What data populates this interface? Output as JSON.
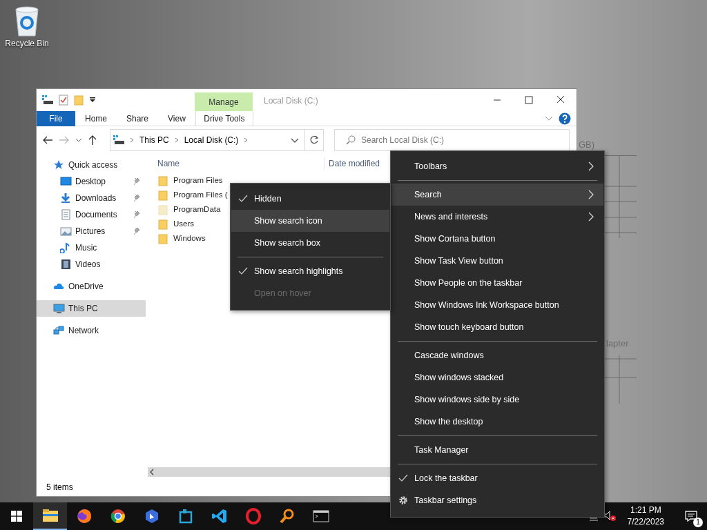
{
  "desktop": {
    "icons": [
      {
        "label": "Recycle Bin"
      }
    ],
    "background_texts": [
      "GB)",
      "lapter"
    ]
  },
  "explorer": {
    "title": "Local Disk (C:)",
    "context_group": "Manage",
    "ribbon_tabs": [
      {
        "label": "File",
        "kind": "file"
      },
      {
        "label": "Home",
        "kind": "tab"
      },
      {
        "label": "Share",
        "kind": "tab"
      },
      {
        "label": "View",
        "kind": "tab"
      },
      {
        "label": "Drive Tools",
        "kind": "context"
      }
    ],
    "breadcrumbs": [
      "This PC",
      "Local Disk (C:)"
    ],
    "search": {
      "placeholder": "Search Local Disk (C:)"
    },
    "nav": [
      {
        "label": "Quick access",
        "selected": false,
        "pinned": false,
        "children": [
          {
            "label": "Desktop",
            "selected": false,
            "pinned": true
          },
          {
            "label": "Downloads",
            "selected": false,
            "pinned": true
          },
          {
            "label": "Documents",
            "selected": false,
            "pinned": true
          },
          {
            "label": "Pictures",
            "selected": false,
            "pinned": true
          },
          {
            "label": "Music",
            "selected": false,
            "pinned": false
          },
          {
            "label": "Videos",
            "selected": false,
            "pinned": false
          }
        ]
      },
      {
        "label": "OneDrive",
        "selected": false,
        "pinned": false
      },
      {
        "label": "This PC",
        "selected": true,
        "pinned": false
      },
      {
        "label": "Network",
        "selected": false,
        "pinned": false
      }
    ],
    "columns": [
      "Name",
      "Date modified"
    ],
    "files": [
      {
        "name": "Program Files",
        "hidden": false
      },
      {
        "name": "Program Files (",
        "hidden": false
      },
      {
        "name": "ProgramData",
        "hidden": true
      },
      {
        "name": "Users",
        "hidden": false
      },
      {
        "name": "Windows",
        "hidden": false
      }
    ],
    "status": "5 items"
  },
  "taskbar_menu": [
    {
      "kind": "item",
      "label": "Toolbars",
      "submenu": true,
      "selected": false,
      "checked": false
    },
    {
      "kind": "separator"
    },
    {
      "kind": "item",
      "label": "Search",
      "submenu": true,
      "selected": true,
      "checked": false
    },
    {
      "kind": "item",
      "label": "News and interests",
      "submenu": true,
      "selected": false,
      "checked": false
    },
    {
      "kind": "item",
      "label": "Show Cortana button",
      "submenu": false,
      "selected": false,
      "checked": false
    },
    {
      "kind": "item",
      "label": "Show Task View button",
      "submenu": false,
      "selected": false,
      "checked": false
    },
    {
      "kind": "item",
      "label": "Show People on the taskbar",
      "submenu": false,
      "selected": false,
      "checked": false
    },
    {
      "kind": "item",
      "label": "Show Windows Ink Workspace button",
      "submenu": false,
      "selected": false,
      "checked": false
    },
    {
      "kind": "item",
      "label": "Show touch keyboard button",
      "submenu": false,
      "selected": false,
      "checked": false
    },
    {
      "kind": "separator"
    },
    {
      "kind": "item",
      "label": "Cascade windows",
      "submenu": false,
      "selected": false,
      "checked": false
    },
    {
      "kind": "item",
      "label": "Show windows stacked",
      "submenu": false,
      "selected": false,
      "checked": false
    },
    {
      "kind": "item",
      "label": "Show windows side by side",
      "submenu": false,
      "selected": false,
      "checked": false
    },
    {
      "kind": "item",
      "label": "Show the desktop",
      "submenu": false,
      "selected": false,
      "checked": false
    },
    {
      "kind": "separator"
    },
    {
      "kind": "item",
      "label": "Task Manager",
      "submenu": false,
      "selected": false,
      "checked": false
    },
    {
      "kind": "separator"
    },
    {
      "kind": "item",
      "label": "Lock the taskbar",
      "submenu": false,
      "selected": false,
      "checked": true
    },
    {
      "kind": "settings",
      "label": "Taskbar settings",
      "submenu": false,
      "selected": false,
      "checked": false
    }
  ],
  "search_submenu": [
    {
      "kind": "item",
      "label": "Hidden",
      "selected": false,
      "checked": true,
      "disabled": false
    },
    {
      "kind": "item",
      "label": "Show search icon",
      "selected": true,
      "checked": false,
      "disabled": false
    },
    {
      "kind": "item",
      "label": "Show search box",
      "selected": false,
      "checked": false,
      "disabled": false
    },
    {
      "kind": "separator"
    },
    {
      "kind": "item",
      "label": "Show search highlights",
      "selected": false,
      "checked": true,
      "disabled": false
    },
    {
      "kind": "item",
      "label": "Open on hover",
      "selected": false,
      "checked": false,
      "disabled": true
    }
  ],
  "taskbar": {
    "apps": [
      {
        "active": true
      },
      {
        "active": false
      },
      {
        "active": false
      },
      {
        "active": false
      },
      {
        "active": false
      },
      {
        "active": false
      },
      {
        "active": false
      },
      {
        "active": false
      },
      {
        "active": false
      }
    ],
    "time": "1:21 PM",
    "date": "7/22/2023",
    "notifications": "1"
  }
}
